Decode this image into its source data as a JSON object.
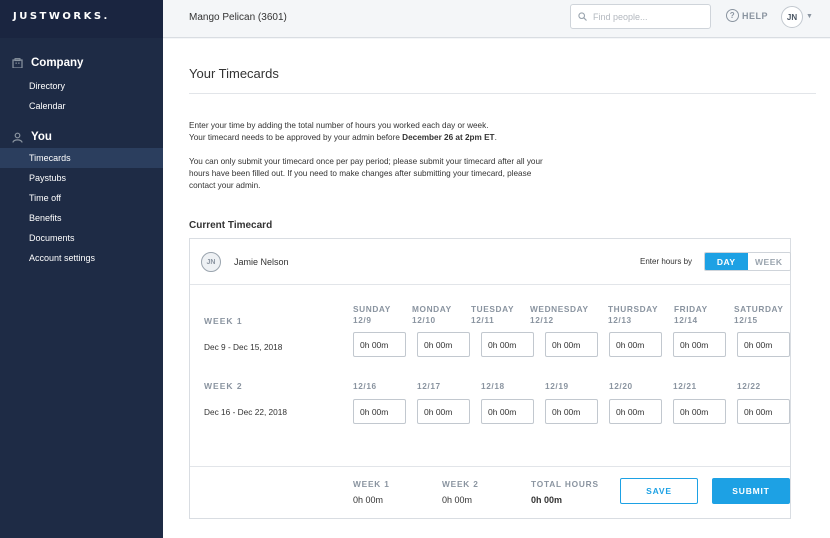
{
  "app": {
    "logo": "JUSTWORKS."
  },
  "sidebar": {
    "company_label": "Company",
    "company_items": [
      {
        "label": "Directory"
      },
      {
        "label": "Calendar"
      }
    ],
    "you_label": "You",
    "you_items": [
      {
        "label": "Timecards",
        "active": true
      },
      {
        "label": "Paystubs"
      },
      {
        "label": "Time off"
      },
      {
        "label": "Benefits"
      },
      {
        "label": "Documents"
      },
      {
        "label": "Account settings"
      }
    ]
  },
  "header": {
    "company": "Mango Pelican (3601)",
    "search_placeholder": "Find people...",
    "help_label": "HELP",
    "user_initials": "JN"
  },
  "main": {
    "title": "Your Timecards",
    "intro_line1": "Enter your time by adding the total number of hours you worked each day or week.",
    "intro_line2_prefix": "Your timecard needs to be approved by your admin before ",
    "intro_deadline": "December 26 at 2pm ET",
    "intro_line2_suffix": ".",
    "intro_para2": "You can only submit your timecard once per pay period; please submit your timecard after all your hours have been filled out. If you need to make changes after submitting your timecard, please contact your admin.",
    "section_title": "Current Timecard"
  },
  "timecard": {
    "employee_initials": "JN",
    "employee_name": "Jamie Nelson",
    "enter_hours_label": "Enter hours by",
    "toggle_day": "DAY",
    "toggle_week": "WEEK",
    "toggle_selected": "DAY",
    "days": [
      "SUNDAY",
      "MONDAY",
      "TUESDAY",
      "WEDNESDAY",
      "THURSDAY",
      "FRIDAY",
      "SATURDAY"
    ],
    "weeks": [
      {
        "label": "WEEK 1",
        "range": "Dec 9 - Dec 15, 2018",
        "dates": [
          "12/9",
          "12/10",
          "12/11",
          "12/12",
          "12/13",
          "12/14",
          "12/15"
        ],
        "hours": [
          "0h 00m",
          "0h 00m",
          "0h 00m",
          "0h 00m",
          "0h 00m",
          "0h 00m",
          "0h 00m"
        ]
      },
      {
        "label": "WEEK 2",
        "range": "Dec 16 - Dec 22, 2018",
        "dates": [
          "12/16",
          "12/17",
          "12/18",
          "12/19",
          "12/20",
          "12/21",
          "12/22"
        ],
        "hours": [
          "0h 00m",
          "0h 00m",
          "0h 00m",
          "0h 00m",
          "0h 00m",
          "0h 00m",
          "0h 00m"
        ]
      }
    ],
    "totals": {
      "week1_label": "WEEK 1",
      "week1_value": "0h 00m",
      "week2_label": "WEEK 2",
      "week2_value": "0h 00m",
      "total_label": "TOTAL HOURS",
      "total_value": "0h 00m"
    },
    "save_label": "SAVE",
    "submit_label": "SUBMIT"
  },
  "colors": {
    "accent": "#1da1e4",
    "sidebar_bg": "#1e2b45",
    "sidebar_active": "#2b3e5e"
  }
}
